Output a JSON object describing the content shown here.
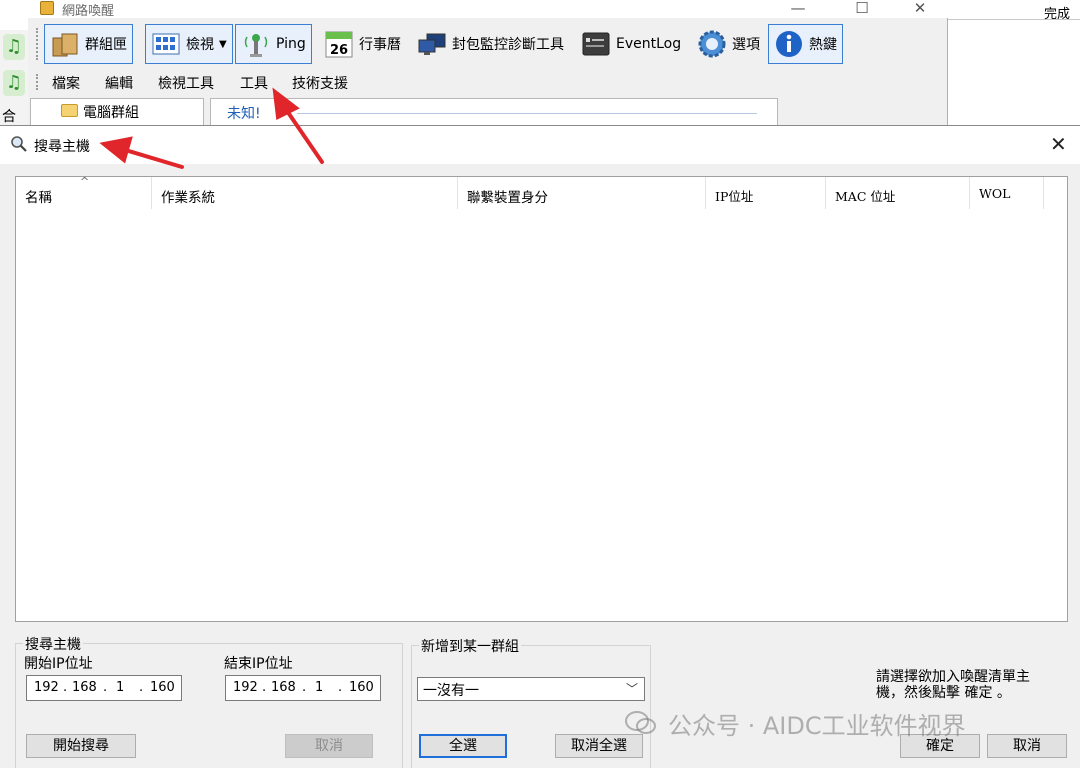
{
  "background_window": {
    "title": "網路喚醒",
    "toolbar": [
      {
        "label": "群組匣",
        "icon": "box-icon"
      },
      {
        "label": "檢視",
        "icon": "grid-view-icon"
      },
      {
        "label": "Ping",
        "icon": "antenna-icon"
      },
      {
        "label": "行事曆",
        "icon": "calendar-icon",
        "day": "26"
      },
      {
        "label": "封包監控診斷工具",
        "icon": "monitor-icon"
      },
      {
        "label": "EventLog",
        "icon": "eventlog-icon"
      },
      {
        "label": "選項",
        "icon": "gear-icon"
      },
      {
        "label": "熱鍵",
        "icon": "info-icon"
      }
    ],
    "menu": [
      "檔案",
      "編輯",
      "檢視工具",
      "工具",
      "技術支援"
    ],
    "tree_label": "電腦群組",
    "panel_label": "未知!",
    "left_strip_label": "合",
    "right_status": "完成"
  },
  "dialog": {
    "title": "搜尋主機",
    "columns": [
      "名稱",
      "作業系統",
      "聯繫裝置身分",
      "IP位址",
      "MAC 位址",
      "WOL"
    ],
    "search_group": {
      "title": "搜尋主機",
      "start_ip_label": "開始IP位址",
      "end_ip_label": "結束IP位址",
      "start_ip": [
        "192",
        "168",
        "1",
        "160"
      ],
      "end_ip": [
        "192",
        "168",
        "1",
        "160"
      ],
      "start_button": "開始搜尋",
      "cancel_button": "取消"
    },
    "group_section": {
      "title": "新增到某一群組",
      "selected": "一沒有一",
      "select_all": "全選",
      "deselect_all": "取消全選"
    },
    "hint": "請選擇欲加入喚醒清單主機，然後點擊 確定 。",
    "ok_button": "確定",
    "cancel_button": "取消"
  },
  "watermark": "公众号 · AIDC工业软件视界",
  "colors": {
    "accent": "#1e6fd9",
    "annotation_arrow": "#e0262a"
  }
}
